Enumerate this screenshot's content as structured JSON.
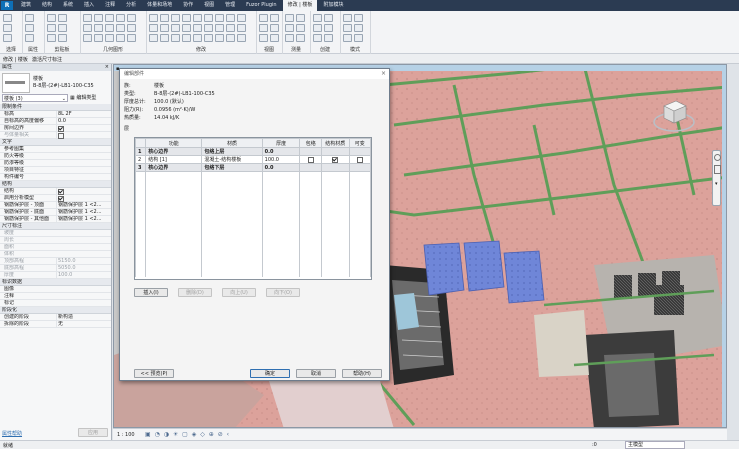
{
  "ribbon": {
    "logo": "R",
    "tabs": [
      "建筑",
      "结构",
      "系统",
      "插入",
      "注释",
      "分析",
      "体量和场地",
      "协作",
      "视图",
      "管理",
      "Fuzor Plugin",
      "修改 | 楼板",
      "附加模块"
    ],
    "active_tab_index": 11,
    "panels": [
      "选择",
      "属性",
      "剪贴板",
      "几何图形",
      "修改",
      "视图",
      "测量",
      "创建",
      "模式"
    ]
  },
  "options_bar": {
    "label1": "修改 | 楼板",
    "label2": "激活尺寸标注"
  },
  "properties": {
    "title": "属性",
    "type_family": "楼板",
    "type_name": "B-8层-(2#)-LB1-100-C35",
    "selector": "楼板 (3)",
    "edit_type": "编辑类型",
    "sections": {
      "constraints": "限制条件",
      "text": "文字",
      "structure": "结构",
      "dimensions": "尺寸标注",
      "identity": "标识数据",
      "phasing": "阶段化"
    },
    "rows_constraints": [
      [
        "标高",
        "8L 2F"
      ],
      [
        "自标高的高度偏移",
        "0.0"
      ],
      [
        "房间边界",
        "check"
      ],
      [
        "与体量相关",
        "check-off"
      ]
    ],
    "rows_text": [
      [
        "参考图集",
        ""
      ],
      [
        "防火等级",
        ""
      ],
      [
        "防渗等级",
        ""
      ],
      [
        "项目特征",
        ""
      ],
      [
        "构件编号",
        ""
      ]
    ],
    "rows_structure": [
      [
        "结构",
        "check"
      ],
      [
        "启用分析模型",
        "check"
      ],
      [
        "钢筋保护层 - 顶面",
        "钢筋保护层 1 <2..."
      ],
      [
        "钢筋保护层 - 底面",
        "钢筋保护层 1 <2..."
      ],
      [
        "钢筋保护层 - 其他面",
        "钢筋保护层 1 <2..."
      ]
    ],
    "rows_dimensions": [
      [
        "坡度",
        ""
      ],
      [
        "周长",
        ""
      ],
      [
        "面积",
        ""
      ],
      [
        "体积",
        ""
      ],
      [
        "顶部高程",
        "5150.0"
      ],
      [
        "底部高程",
        "5050.0"
      ],
      [
        "厚度",
        "100.0"
      ]
    ],
    "rows_identity": [
      [
        "图像",
        ""
      ],
      [
        "注释",
        ""
      ],
      [
        "标记",
        ""
      ]
    ],
    "rows_phasing": [
      [
        "创建的阶段",
        "新构造"
      ],
      [
        "拆除的阶段",
        "无"
      ]
    ],
    "help_link": "属性帮助",
    "apply": "应用"
  },
  "dialog": {
    "title": "编辑部件",
    "info": [
      [
        "族:",
        "楼板"
      ],
      [
        "类型:",
        "B-8层-(2#)-LB1-100-C35"
      ],
      [
        "厚度总计:",
        "100.0 (默认)"
      ],
      [
        "阻力(R):",
        "0.0956 (m²·K)/W"
      ],
      [
        "热质量:",
        "14.04 kJ/K"
      ]
    ],
    "layers_label": "层",
    "columns": [
      "",
      "功能",
      "材质",
      "厚度",
      "包络",
      "结构材质",
      "可变"
    ],
    "rows": [
      {
        "n": "1",
        "func": "核心边界",
        "mat": "包络上层",
        "thk": "0.0",
        "wrap": "",
        "struct": "",
        "var": "",
        "bold": true
      },
      {
        "n": "2",
        "func": "结构 [1]",
        "mat": "混凝土-结构楼板",
        "thk": "100.0",
        "wrap": "off",
        "struct": "on",
        "var": "off",
        "bold": false
      },
      {
        "n": "3",
        "func": "核心边界",
        "mat": "包络下层",
        "thk": "0.0",
        "wrap": "",
        "struct": "",
        "var": "",
        "bold": true
      }
    ],
    "buttons": {
      "insert": "插入(I)",
      "delete": "删除(D)",
      "up": "向上(U)",
      "down": "向下(O)",
      "preview": "<< 预览(P)",
      "ok": "确定",
      "cancel": "取消",
      "help": "帮助(H)"
    }
  },
  "view_controls": {
    "scale": "1 : 100"
  },
  "statusbar": {
    "left": "就绪",
    "model": "主模型",
    "zero": ":0"
  },
  "colors": {
    "ribbon_dark": "#2b3b52",
    "floor_pink": "#dca29b",
    "beam_green": "#5f9e59",
    "water_blue": "#6f86d8",
    "accent": "#2f6fb1"
  }
}
